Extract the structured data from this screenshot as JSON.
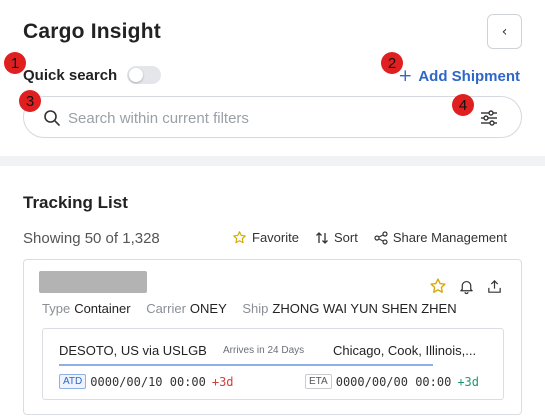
{
  "header": {
    "title": "Cargo Insight",
    "collapse_icon": "chevron-left-icon"
  },
  "quick_search": {
    "label": "Quick search",
    "enabled": false
  },
  "add_shipment": {
    "label": "Add Shipment",
    "icon": "plus-icon",
    "color": "#2f67c9"
  },
  "search": {
    "placeholder": "Search within current filters",
    "value": ""
  },
  "annotations": [
    "1",
    "2",
    "3",
    "4"
  ],
  "tracking": {
    "title": "Tracking List",
    "count_text": "Showing 50 of 1,328",
    "actions": {
      "favorite": "Favorite",
      "sort": "Sort",
      "share": "Share Management"
    }
  },
  "shipment": {
    "type_label": "Type",
    "type_value": "Container",
    "carrier_label": "Carrier",
    "carrier_value": "ONEY",
    "ship_label": "Ship",
    "ship_value": "ZHONG WAI YUN SHEN ZHEN",
    "leg": {
      "origin": "DESOTO, US via USLGB",
      "arrives": "Arrives in 24 Days",
      "destination": "Chicago, Cook, Illinois,...",
      "atd_label": "ATD",
      "atd_value": "0000/00/10 00:00",
      "atd_delta": "+3d",
      "eta_label": "ETA",
      "eta_value": "0000/00/00 00:00",
      "eta_delta": "+3d"
    }
  },
  "colors": {
    "accent": "#2f67c9",
    "badge": "#e02020",
    "delay": "#d93b3b",
    "ok": "#1f9a6a"
  }
}
